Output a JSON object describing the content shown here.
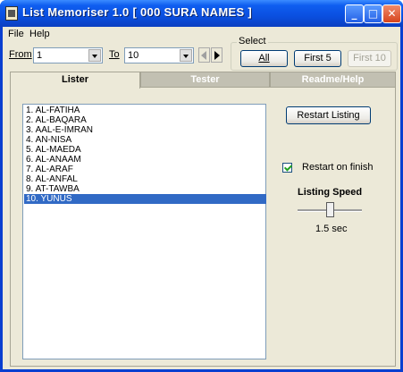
{
  "window": {
    "title": "List Memoriser 1.0 [ 000 SURA NAMES ]",
    "controls": {
      "minimize": "_",
      "maximize": "□",
      "close": "✕"
    }
  },
  "menu": {
    "file": "File",
    "help": "Help"
  },
  "range": {
    "from_label": "From",
    "from_value": "1",
    "to_label": "To",
    "to_value": "10"
  },
  "select_group": {
    "title": "Select",
    "all": "All",
    "first5": "First 5",
    "first10": "First 10"
  },
  "tabs": [
    {
      "label": "Lister",
      "active": true
    },
    {
      "label": "Tester",
      "active": false
    },
    {
      "label": "Readme/Help",
      "active": false
    }
  ],
  "list": {
    "items": [
      "1. AL-FATIHA",
      "2. AL-BAQARA",
      "3. AAL-E-IMRAN",
      "4. AN-NISA",
      "5. AL-MAEDA",
      "6. AL-ANAAM",
      "7. AL-ARAF",
      "8. AL-ANFAL",
      "9. AT-TAWBA",
      "10. YUNUS"
    ],
    "selected_index": 9
  },
  "controls": {
    "restart_button": "Restart Listing",
    "restart_on_finish_label": "Restart on finish",
    "restart_on_finish_checked": true,
    "speed_label": "Listing Speed",
    "speed_value": "1.5 sec"
  },
  "colors": {
    "titlebar": "#0a4fe0",
    "selection": "#316ac5",
    "face": "#ece9d8"
  }
}
